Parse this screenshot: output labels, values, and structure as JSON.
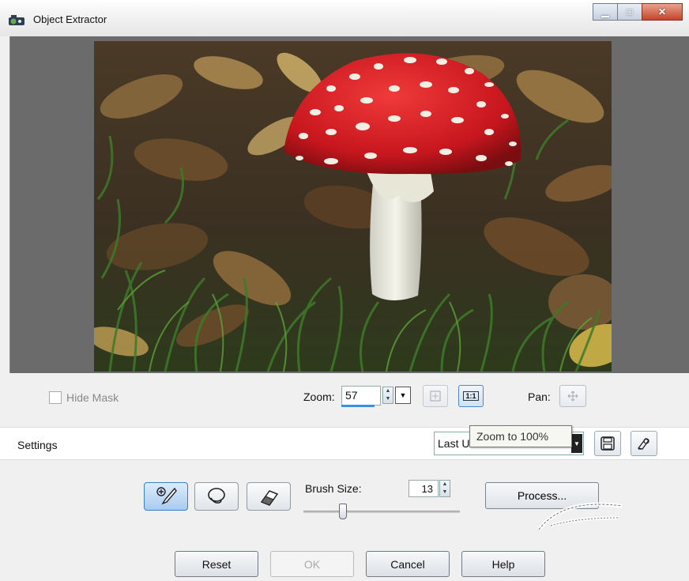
{
  "window": {
    "title": "Object Extractor",
    "minimize_icon": "minimize-icon",
    "maximize_icon": "maximize-icon",
    "close_icon": "close-icon"
  },
  "preview": {
    "image": "mushroom-photo"
  },
  "zoom_bar": {
    "hide_mask_label": "Hide Mask",
    "hide_mask_checked": false,
    "zoom_label": "Zoom:",
    "zoom_value": "57",
    "fit_icon": "fit-to-window-icon",
    "one_to_one_icon": "zoom-100-icon",
    "one_to_one_glyph": "1:1",
    "pan_label": "Pan:",
    "pan_icon": "pan-icon"
  },
  "settings_bar": {
    "label": "Settings",
    "preset_value": "Last U",
    "tooltip": "Zoom to 100%",
    "save_icon": "save-preset-icon",
    "load_icon": "load-preset-icon"
  },
  "tools": {
    "brush_icon": "highlighter-brush-icon",
    "lasso_icon": "lasso-icon",
    "eraser_icon": "eraser-icon",
    "brush_size_label": "Brush Size:",
    "brush_size_value": "13",
    "brush_size_fraction": 0.25,
    "process_label": "Process..."
  },
  "buttons": {
    "reset": "Reset",
    "ok": "OK",
    "cancel": "Cancel",
    "help": "Help"
  },
  "colors": {
    "accent": "#3a8ee6",
    "mushroom_cap": "#d8232a"
  }
}
